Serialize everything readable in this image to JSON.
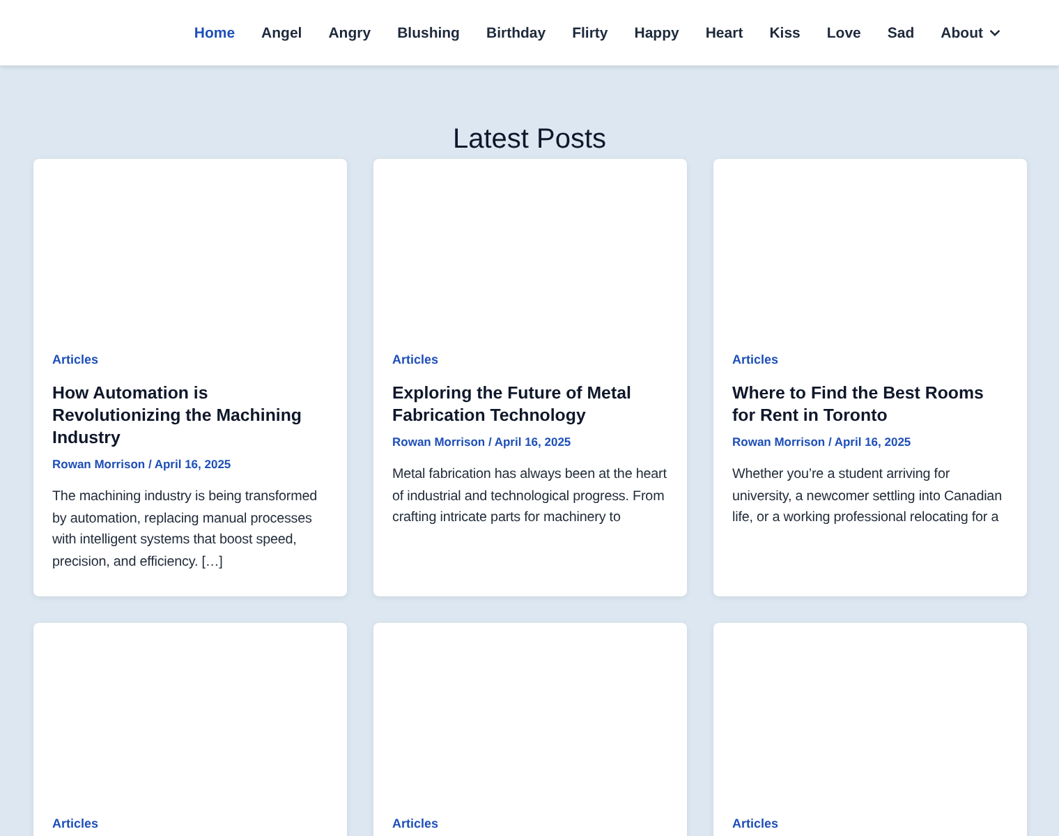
{
  "nav": {
    "items": [
      {
        "label": "Home",
        "selected": true,
        "dropdown": false
      },
      {
        "label": "Angel",
        "selected": false,
        "dropdown": false
      },
      {
        "label": "Angry",
        "selected": false,
        "dropdown": false
      },
      {
        "label": "Blushing",
        "selected": false,
        "dropdown": false
      },
      {
        "label": "Birthday",
        "selected": false,
        "dropdown": false
      },
      {
        "label": "Flirty",
        "selected": false,
        "dropdown": false
      },
      {
        "label": "Happy",
        "selected": false,
        "dropdown": false
      },
      {
        "label": "Heart",
        "selected": false,
        "dropdown": false
      },
      {
        "label": "Kiss",
        "selected": false,
        "dropdown": false
      },
      {
        "label": "Love",
        "selected": false,
        "dropdown": false
      },
      {
        "label": "Sad",
        "selected": false,
        "dropdown": false
      },
      {
        "label": "About",
        "selected": false,
        "dropdown": true
      }
    ]
  },
  "heading": "Latest Posts",
  "posts": [
    {
      "category": "Articles",
      "title": "How Automation is Revolutionizing the Machining Industry",
      "meta": "Rowan Morrison / April 16, 2025",
      "excerpt": "The machining industry is being transformed by automation, replacing manual processes with intelligent systems that boost speed, precision, and efficiency. […]"
    },
    {
      "category": "Articles",
      "title": "Exploring the Future of Metal Fabrication Technology",
      "meta": "Rowan Morrison / April 16, 2025",
      "excerpt": "Metal fabrication has always been at the heart of industrial and technological progress. From crafting intricate parts for machinery to"
    },
    {
      "category": "Articles",
      "title": "Where to Find the Best Rooms for Rent in Toronto",
      "meta": "Rowan Morrison / April 16, 2025",
      "excerpt": "Whether you’re a student arriving for university, a newcomer settling into Canadian life, or a working professional relocating for a"
    },
    {
      "category": "Articles"
    },
    {
      "category": "Articles"
    },
    {
      "category": "Articles"
    }
  ]
}
